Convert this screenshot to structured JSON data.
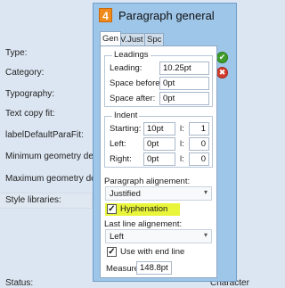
{
  "background_panel": {
    "labels": [
      "Type:",
      "Category:",
      "Typography:",
      "Text copy fit:",
      "labelDefaultParaFit:",
      "Minimum geometry de",
      "Maximum geometry de",
      "Style libraries:",
      "Status:"
    ],
    "partial_text": "Character"
  },
  "dialog": {
    "icon_text": "4",
    "title": "Paragraph general",
    "tabs": [
      "Gen",
      "V.Just",
      "Spc"
    ],
    "leadings": {
      "title": "Leadings",
      "leading_label": "Leading:",
      "leading_value": "10.25pt",
      "space_before_label": "Space before:",
      "space_before_value": "0pt",
      "space_after_label": "Space after:",
      "space_after_value": "0pt"
    },
    "indent": {
      "title": "Indent",
      "starting_label": "Starting:",
      "starting_value": "10pt",
      "starting_lines_label": "l:",
      "starting_lines_value": "1",
      "left_label": "Left:",
      "left_value": "0pt",
      "left_lines_label": "l:",
      "left_lines_value": "0",
      "right_label": "Right:",
      "right_value": "0pt",
      "right_lines_label": "l:",
      "right_lines_value": "0"
    },
    "paragraph_alignment": {
      "label": "Paragraph alignement:",
      "value": "Justified"
    },
    "hyphenation": {
      "label": "Hyphenation",
      "checked": true
    },
    "last_line_alignment": {
      "label": "Last line alignement:",
      "value": "Left"
    },
    "use_with_end_line": {
      "label": "Use with end line",
      "checked": true
    },
    "measure": {
      "label": "Measure:",
      "value": "148.8pt"
    },
    "ok_icon": "check-icon",
    "cancel_icon": "close-icon",
    "colors": {
      "dialog_bg": "#9ec6e9",
      "highlight": "#e9f53a",
      "ok": "#3f9c2b",
      "cancel": "#d33b2c",
      "app_icon": "#f08a1c"
    }
  }
}
